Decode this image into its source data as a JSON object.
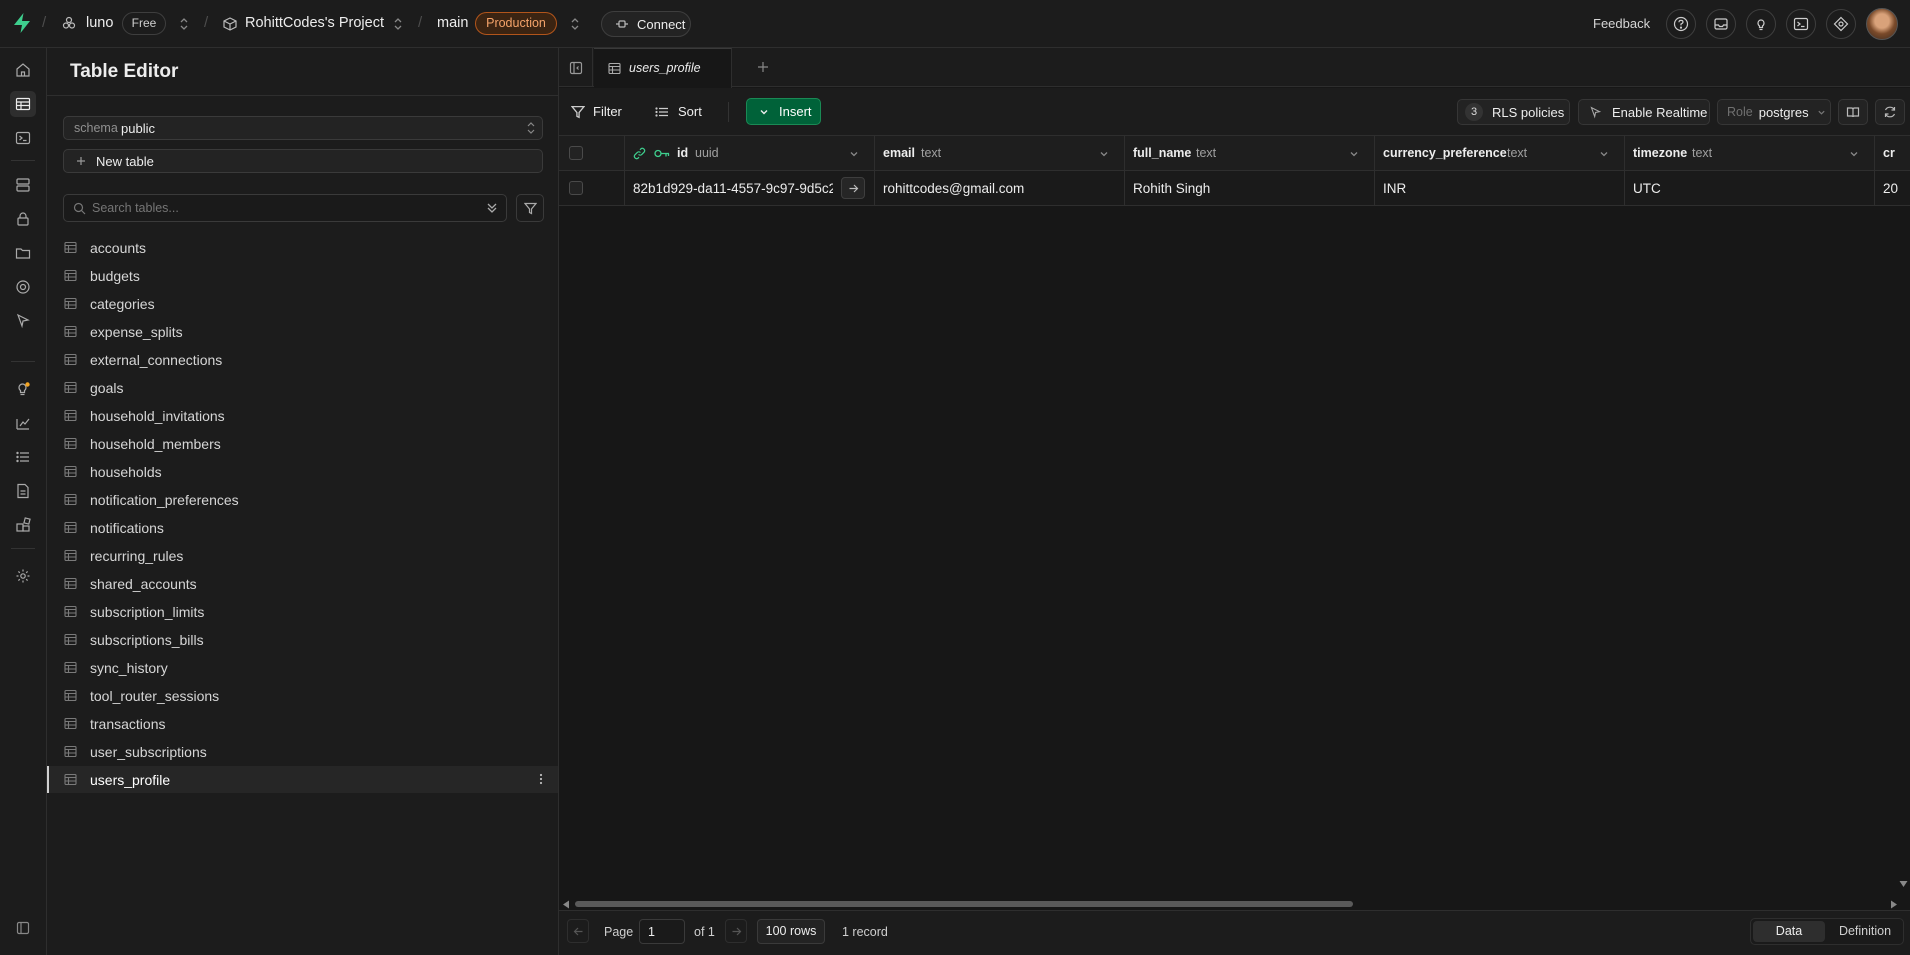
{
  "topbar": {
    "org": "luno",
    "plan": "Free",
    "project": "RohittCodes's Project",
    "branch": "main",
    "environment": "Production",
    "connect": "Connect",
    "feedback": "Feedback"
  },
  "sidebar": {
    "title": "Table Editor",
    "schema_label": "schema",
    "schema_value": "public",
    "new_table": "New table",
    "search_placeholder": "Search tables...",
    "tables": [
      {
        "label": "accounts"
      },
      {
        "label": "budgets"
      },
      {
        "label": "categories"
      },
      {
        "label": "expense_splits"
      },
      {
        "label": "external_connections"
      },
      {
        "label": "goals"
      },
      {
        "label": "household_invitations"
      },
      {
        "label": "household_members"
      },
      {
        "label": "households"
      },
      {
        "label": "notification_preferences"
      },
      {
        "label": "notifications"
      },
      {
        "label": "recurring_rules"
      },
      {
        "label": "shared_accounts"
      },
      {
        "label": "subscription_limits"
      },
      {
        "label": "subscriptions_bills"
      },
      {
        "label": "sync_history"
      },
      {
        "label": "tool_router_sessions"
      },
      {
        "label": "transactions"
      },
      {
        "label": "user_subscriptions"
      },
      {
        "label": "users_profile"
      }
    ],
    "active_table": "users_profile"
  },
  "tabs": [
    {
      "label": "users_profile",
      "active": true
    }
  ],
  "toolbar": {
    "filter": "Filter",
    "sort": "Sort",
    "insert": "Insert",
    "rls_count": "3",
    "rls_label": "RLS policies",
    "realtime": "Enable Realtime",
    "role_label": "Role",
    "role_value": "postgres"
  },
  "grid": {
    "columns": [
      {
        "name": "id",
        "type": "uuid"
      },
      {
        "name": "email",
        "type": "text"
      },
      {
        "name": "full_name",
        "type": "text"
      },
      {
        "name": "currency_preference",
        "type": "text"
      },
      {
        "name": "timezone",
        "type": "text"
      },
      {
        "name": "cr",
        "type": ""
      }
    ],
    "rows": [
      {
        "id": "82b1d929-da11-4557-9c97-9d5c2...",
        "email": "rohittcodes@gmail.com",
        "full_name": "Rohith Singh",
        "currency_preference": "INR",
        "timezone": "UTC",
        "cr": "20"
      }
    ]
  },
  "footer": {
    "page_label": "Page",
    "page_value": "1",
    "of_label": "of 1",
    "rows": "100 rows",
    "records": "1 record",
    "view_data": "Data",
    "view_definition": "Definition"
  },
  "colors": {
    "brand": "#3ecf8e",
    "insert_button": "#006239",
    "production_badge": "#f5a36a"
  }
}
